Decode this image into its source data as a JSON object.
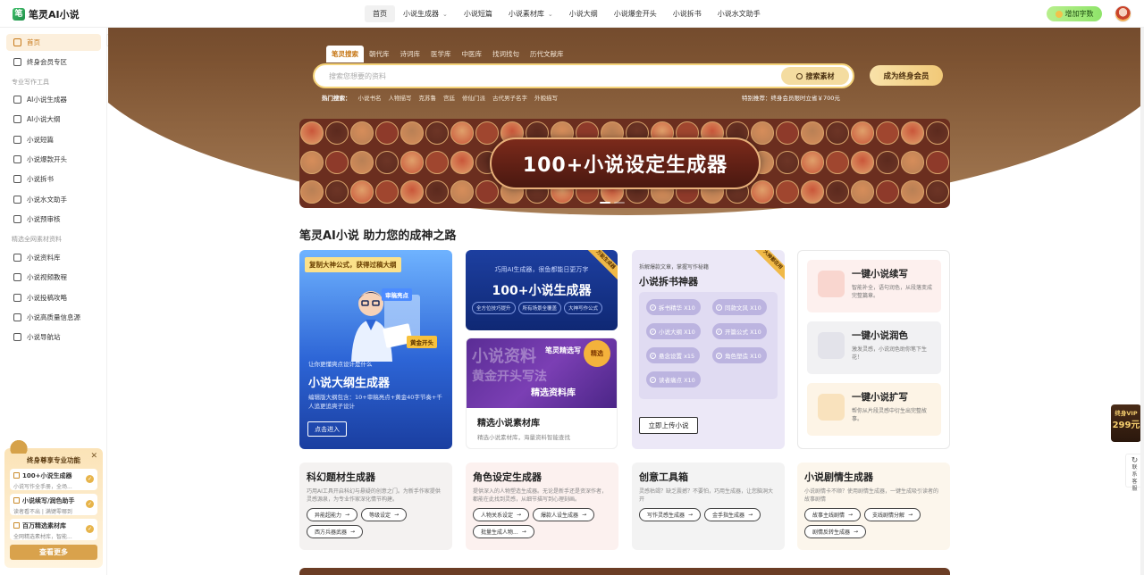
{
  "app": {
    "name": "笔灵AI小说",
    "logo_glyph": "笔"
  },
  "nav": {
    "items": [
      {
        "label": "首页",
        "active": true,
        "chevron": false
      },
      {
        "label": "小说生成器",
        "active": false,
        "chevron": true
      },
      {
        "label": "小说短篇",
        "active": false,
        "chevron": false
      },
      {
        "label": "小说素材库",
        "active": false,
        "chevron": true
      },
      {
        "label": "小说大纲",
        "active": false,
        "chevron": false
      },
      {
        "label": "小说爆金开头",
        "active": false,
        "chevron": false
      },
      {
        "label": "小说拆书",
        "active": false,
        "chevron": false
      },
      {
        "label": "小说水文助手",
        "active": false,
        "chevron": false
      }
    ],
    "add_words": "增加字数"
  },
  "sidebar": {
    "top_items": [
      {
        "label": "首页",
        "icon": "home-icon",
        "active": true
      },
      {
        "label": "终身会员专区",
        "icon": "vip-icon",
        "active": false
      }
    ],
    "group1": "专业写作工具",
    "tools": [
      {
        "label": "AI小说生成器",
        "icon": "book-icon"
      },
      {
        "label": "AI小说大纲",
        "icon": "outline-icon"
      },
      {
        "label": "小说短篇",
        "icon": "doc-icon"
      },
      {
        "label": "小说爆款开头",
        "icon": "opening-icon"
      },
      {
        "label": "小说拆书",
        "icon": "split-icon"
      },
      {
        "label": "小说水文助手",
        "icon": "pen-icon"
      },
      {
        "label": "小说预审核",
        "icon": "review-icon"
      }
    ],
    "group2": "精选全网素材资料",
    "materials": [
      {
        "label": "小说资料库",
        "icon": "folder-icon"
      },
      {
        "label": "小说视频教程",
        "icon": "video-icon"
      },
      {
        "label": "小说投稿攻略",
        "icon": "submit-icon"
      },
      {
        "label": "小说高质量信息源",
        "icon": "chat-icon"
      },
      {
        "label": "小说导航站",
        "icon": "nav-icon"
      }
    ]
  },
  "promo": {
    "title": "终身尊享专业功能",
    "items": [
      {
        "title": "100+小说生成器",
        "sub": "小说写作全手册，全场..."
      },
      {
        "title": "小说续写/润色助手",
        "sub": "读者看不出 | 满键零哪到"
      },
      {
        "title": "百万精选素材库",
        "sub": "全网精选素材库，智能..."
      }
    ],
    "button": "查看更多"
  },
  "hero": {
    "tabs": [
      "笔灵搜索",
      "朝代库",
      "诗词库",
      "医学库",
      "中医库",
      "找词找句",
      "历代文献库"
    ],
    "search_placeholder": "搜索您想要的资料",
    "search_button": "搜索素材",
    "vip_button": "成为终身会员",
    "hot_label": "热门搜索：",
    "hot_terms": [
      "小说书名",
      "人物描写",
      "克苏鲁",
      "宫廷",
      "修仙门派",
      "古代男子名字",
      "外貌描写"
    ],
    "special": "特别推荐：终身会员限时立省￥700元",
    "banner_text": "100+小说设定生成器"
  },
  "section_title": "笔灵AI小说 助力您的成神之路",
  "cards": {
    "outline": {
      "tag": "复制大神公式，获得过稿大纲",
      "float1": "审稿亮点",
      "float2": "黄金开头",
      "sub": "让你更懂爽点设计是什么",
      "title": "小说大纲生成器",
      "desc": "编辑版大纲包含：10+审稿亮点+黄金40字节奏+千人追更追爽子设计",
      "button": "点击进入"
    },
    "generator": {
      "ribbon": "万能生成器",
      "sub": "巧用AI生成器，很鱼都能日更万字",
      "title": "100+小说生成器",
      "chips": [
        "全方位技巧提升",
        "所有场景全覆盖",
        "大神写作公式"
      ]
    },
    "materials": {
      "seal": "精选",
      "art_words": [
        "小说资料",
        "黄金开头写法",
        "精选资料库",
        "笔灵精选写"
      ],
      "title": "精选小说素材库",
      "desc": "精选小说素材库，海量资料智能查找"
    },
    "split": {
      "ribbon": "大神都在用",
      "sub": "拆解爆款文章，掌握写作秘籍",
      "title": "小说拆书神器",
      "pills": [
        "拆书精华 X10",
        "同款文风 X10",
        "小说大纲 X10",
        "开篇公式 X10",
        "悬念设置 x15",
        "角色塑造 X10",
        "读者痛点 X10"
      ],
      "button": "立即上传小说"
    },
    "tools": [
      {
        "title": "一键小说续写",
        "desc": "智能补全，语句润色，从段落变成完整篇章。"
      },
      {
        "title": "一键小说润色",
        "desc": "激发灵感，小说润色助你笔下生花！"
      },
      {
        "title": "一键小说扩写",
        "desc": "帮你从片段灵感中衍生出完整故事。"
      }
    ]
  },
  "generators": [
    {
      "title": "科幻题材生成器",
      "desc": "巧用AI工具开启科幻与悬疑的创意之门。为新手作家提供灵感源泉，为专业作家深化情节构建。",
      "buttons": [
        "异能超能力",
        "等级设定",
        "西方兵器武器"
      ]
    },
    {
      "title": "角色设定生成器",
      "desc": "提供深入的人物塑造生成器。无论是新手还是资深作者，都能在此找到灵感，从细节描写到心理刻画。",
      "buttons": [
        "人物关系设定",
        "爆款人设生成器",
        "批量生成人物..."
      ]
    },
    {
      "title": "创意工具箱",
      "desc": "灵感枯竭？缺乏震撼？不要怕，巧用生成器，让您脑洞大开",
      "buttons": [
        "写作灵感生成器",
        "金手指生成器"
      ]
    },
    {
      "title": "小说剧情生成器",
      "desc": "小说剧情卡不顺？使用剧情生成器，一键生成吸引读者的故事剧情",
      "buttons": [
        "故事主线剧情",
        "支线剧情分解",
        "剧情反转生成器"
      ]
    }
  ],
  "right": {
    "badge_top": "终身VIP",
    "badge_price": "299元",
    "feedback": "联系客服"
  },
  "colors": {
    "accent": "#c77a1b",
    "hero_dark": "#4a2b1a",
    "vip_gold": "#f1c978"
  }
}
